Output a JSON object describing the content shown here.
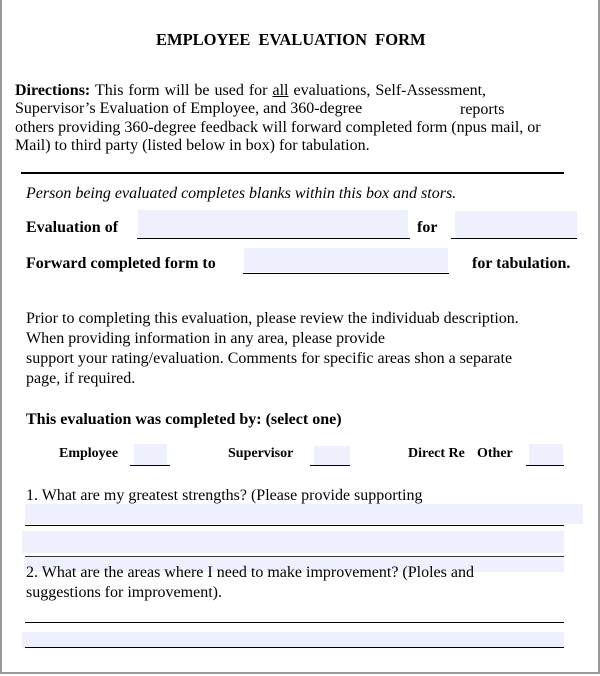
{
  "title": "EMPLOYEE  EVALUATION  FORM",
  "directions": {
    "label": "Directions:",
    "line1_a": "This  form  will  be  used  for",
    "line1_u": "all",
    "line1_b": "evaluations, Self-Assessment,",
    "line2_a": "Supervisor’s Evaluation of Employee, and 360-degree",
    "line2_b": "reports",
    "line3": "others providing 360-degree feedback will forward completed form (npus mail, or",
    "line4": "Mail) to third party (listed below in box) for tabulation."
  },
  "box": {
    "instruction": "Person being evaluated completes blanks within this box and stors.",
    "evaluation_of_label": "Evaluation of",
    "for_label": "for",
    "forward_label": "Forward completed form to",
    "tabulation_label": "for tabulation."
  },
  "prior": {
    "line1": "Prior to completing this evaluation, please review the individuab description.",
    "line2": "When providing information in any area, please provide",
    "line3": "support your rating/evaluation. Comments for specific areas shon a separate",
    "line4": "page, if required."
  },
  "completed_by": {
    "heading": "This evaluation was completed by: (select one)",
    "options": [
      "Employee",
      "Supervisor",
      "Direct Re",
      "Other"
    ]
  },
  "questions": [
    {
      "line1": "1.  What are my greatest strengths? (Please provide supporting"
    },
    {
      "line1": "2.  What are the areas where I need to make improvement? (Ploles and",
      "line2": "suggestions for improvement)."
    }
  ]
}
